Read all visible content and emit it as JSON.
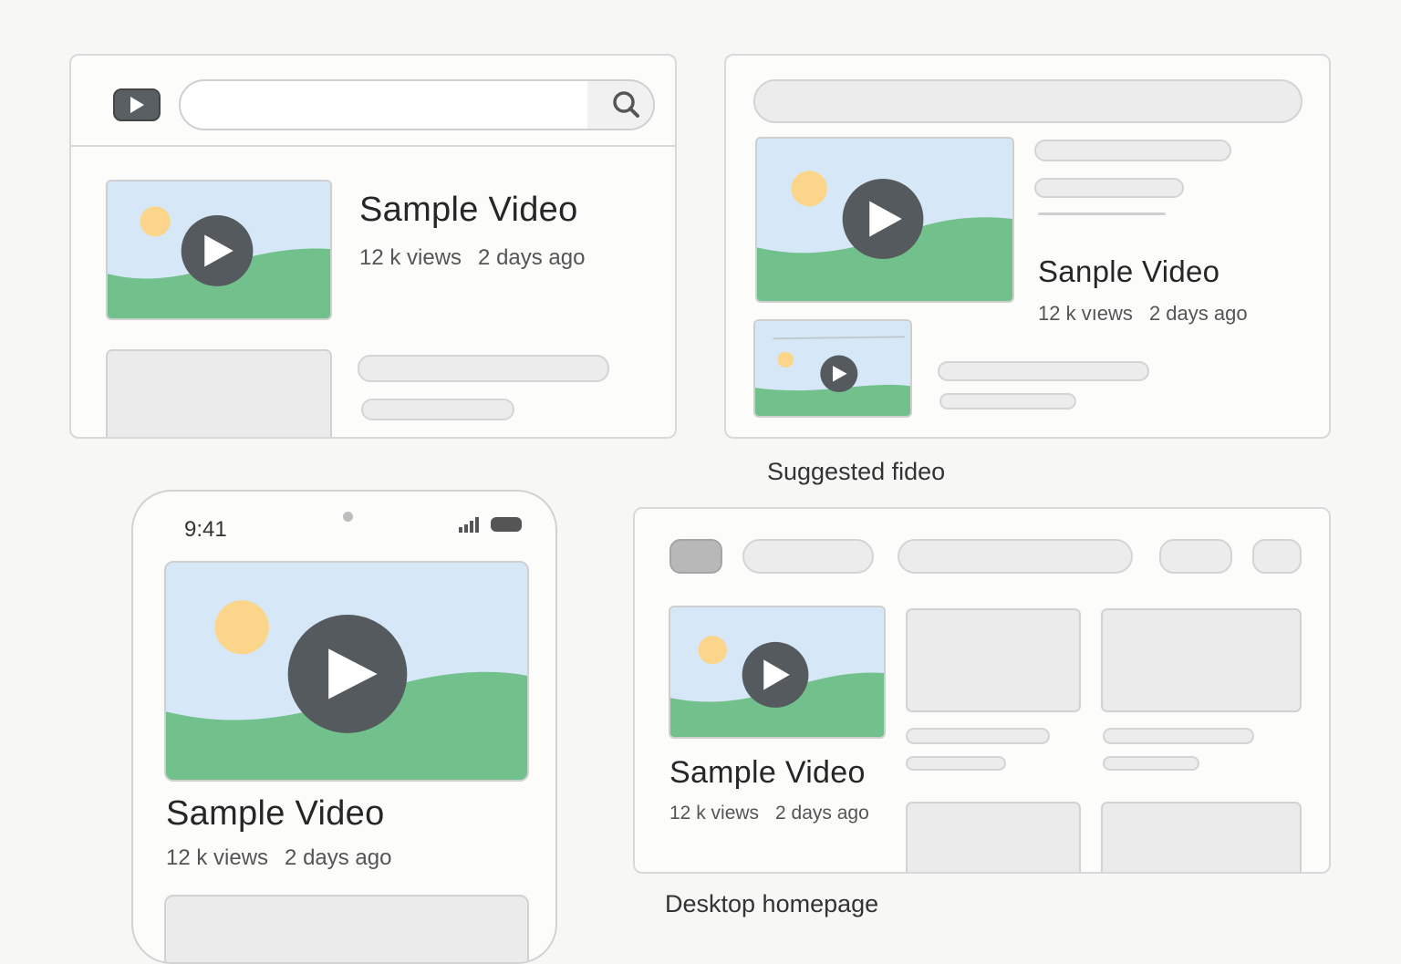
{
  "video": {
    "title_home_search": "Sample Video",
    "title_suggested": "Sanple Video",
    "title_mobile": "Sample Video",
    "title_desktop": "Sample Video",
    "views": "12 k views",
    "views_suggested": "12 k vıews",
    "age": "2 days ago"
  },
  "captions": {
    "suggested": "Suggested fideo",
    "desktop": "Desktop homepage"
  },
  "mobile": {
    "time": "9:41"
  },
  "icons": {
    "logo": "play-logo-icon",
    "search": "search-icon",
    "play": "play-icon",
    "signal": "signal-icon",
    "battery": "battery-icon"
  },
  "colors": {
    "sky": "#d6e8f7",
    "grass": "#72c18c",
    "sun": "#fbd58a",
    "play_button": "#555a5e"
  }
}
